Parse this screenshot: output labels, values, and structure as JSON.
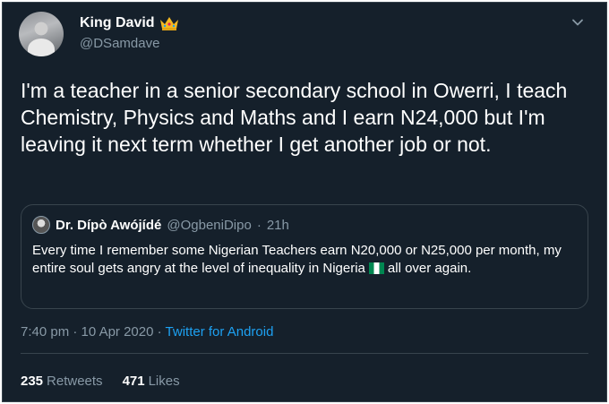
{
  "tweet": {
    "author_name": "King David",
    "author_handle": "@DSamdave",
    "badge_icon": "crown-emoji-icon",
    "text": "I'm a teacher in a senior secondary school in Owerri, I teach Chemistry, Physics and Maths and I earn N24,000 but I'm leaving it next term whether I get another job or not.",
    "time": "7:40 pm",
    "date": "10 Apr 2020",
    "source": "Twitter for Android"
  },
  "quoted": {
    "author_name": "Dr. Dípò Awójídé",
    "author_handle": "@OgbeniDipo",
    "age": "21h",
    "text_before_flag": "Every time I remember some Nigerian Teachers earn N20,000 or N25,000 per month, my entire soul gets angry at the level of inequality in Nigeria",
    "flag_icon": "nigeria-flag-icon",
    "text_after_flag": "all over again."
  },
  "stats": {
    "retweets_count": "235",
    "retweets_label": "Retweets",
    "likes_count": "471",
    "likes_label": "Likes"
  },
  "colors": {
    "background": "#15202b",
    "border": "#38444d",
    "secondary_text": "#8899a6",
    "link": "#1da1f2"
  }
}
